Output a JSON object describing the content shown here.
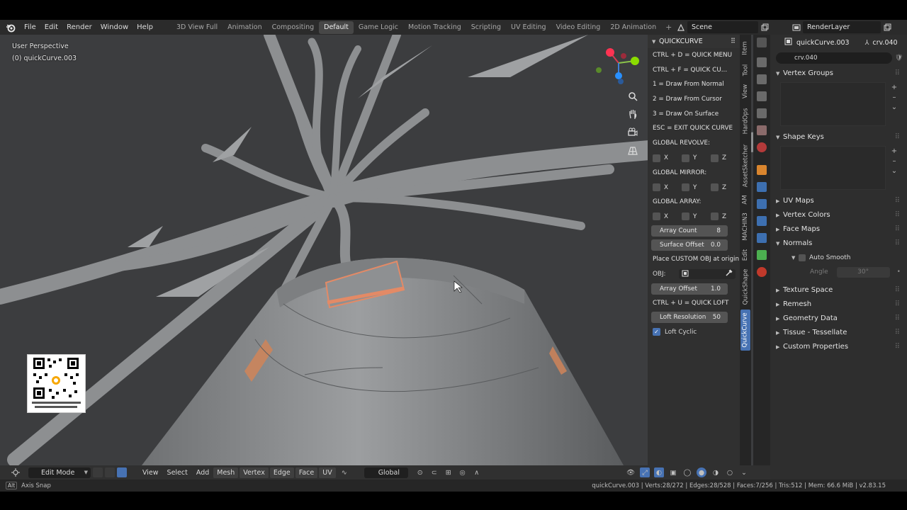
{
  "app": {
    "menu": [
      "File",
      "Edit",
      "Render",
      "Window",
      "Help"
    ],
    "workspaces": [
      "3D View Full",
      "Animation",
      "Compositing",
      "Default",
      "Game Logic",
      "Motion Tracking",
      "Scripting",
      "UV Editing",
      "Video Editing",
      "2D Animation"
    ],
    "active_workspace": "Default",
    "add_tab": "+",
    "scene": "Scene",
    "render_layer": "RenderLayer"
  },
  "viewport": {
    "perspective": "User Perspective",
    "object_label": "(0) quickCurve.003"
  },
  "quickcurve": {
    "title": "QUICKCURVE",
    "rows": [
      "CTRL + D = QUICK MENU",
      "CTRL + F = QUICK CU...",
      "1 = Draw From Normal",
      "2 = Draw From Cursor",
      "3 = Draw On Surface",
      "ESC = EXIT QUICK CURVE"
    ],
    "global_revolve": "GLOBAL REVOLVE:",
    "global_mirror": "GLOBAL MIRROR:",
    "global_array": "GLOBAL ARRAY:",
    "axes": [
      "X",
      "Y",
      "Z"
    ],
    "array_count_label": "Array Count",
    "array_count_value": "8",
    "surface_offset_label": "Surface Offset",
    "surface_offset_value": "0.0",
    "place_custom": "Place CUSTOM OBJ at origin",
    "obj_label": "OBJ:",
    "array_offset_label": "Array Offset",
    "array_offset_value": "1.0",
    "quick_loft": "CTRL + U = QUICK LOFT",
    "loft_resolution_label": "Loft Resolution",
    "loft_resolution_value": "50",
    "loft_cyclic": "Loft Cyclic",
    "loft_cyclic_checked": true
  },
  "vtabs": [
    "Item",
    "Tool",
    "View",
    "HardOps",
    "AssetSketcher",
    "AM",
    "MACHIN3",
    "Edit",
    "QuickShape",
    "QuickCurve"
  ],
  "vtab_active": "QuickCurve",
  "properties": {
    "object_name": "quickCurve.003",
    "data_name": "crv.040",
    "search_value": "crv.040",
    "vertex_groups": "Vertex Groups",
    "shape_keys": "Shape Keys",
    "sections": [
      "UV Maps",
      "Vertex Colors",
      "Face Maps",
      "Normals"
    ],
    "auto_smooth": "Auto Smooth",
    "angle_label": "Angle",
    "angle_value": "30°",
    "sections_after": [
      "Texture Space",
      "Remesh",
      "Geometry Data",
      "Tissue - Tessellate",
      "Custom Properties"
    ]
  },
  "header": {
    "mode": "Edit Mode",
    "menus": [
      "View",
      "Select",
      "Add"
    ],
    "buttons": [
      "Mesh",
      "Vertex",
      "Edge",
      "Face",
      "UV"
    ],
    "transform_orientation": "Global"
  },
  "status": {
    "key": "Alt",
    "hint": "Axis Snap",
    "stats": "quickCurve.003 | Verts:28/272 | Edges:28/528 | Faces:7/256 | Tris:512 | Mem: 66.6 MiB | v2.83.15"
  },
  "colors": {
    "accent": "#4772b3",
    "viewport_bg": "#3c3d3f",
    "panel_bg": "#303030",
    "selection_orange": "#e38a66"
  }
}
